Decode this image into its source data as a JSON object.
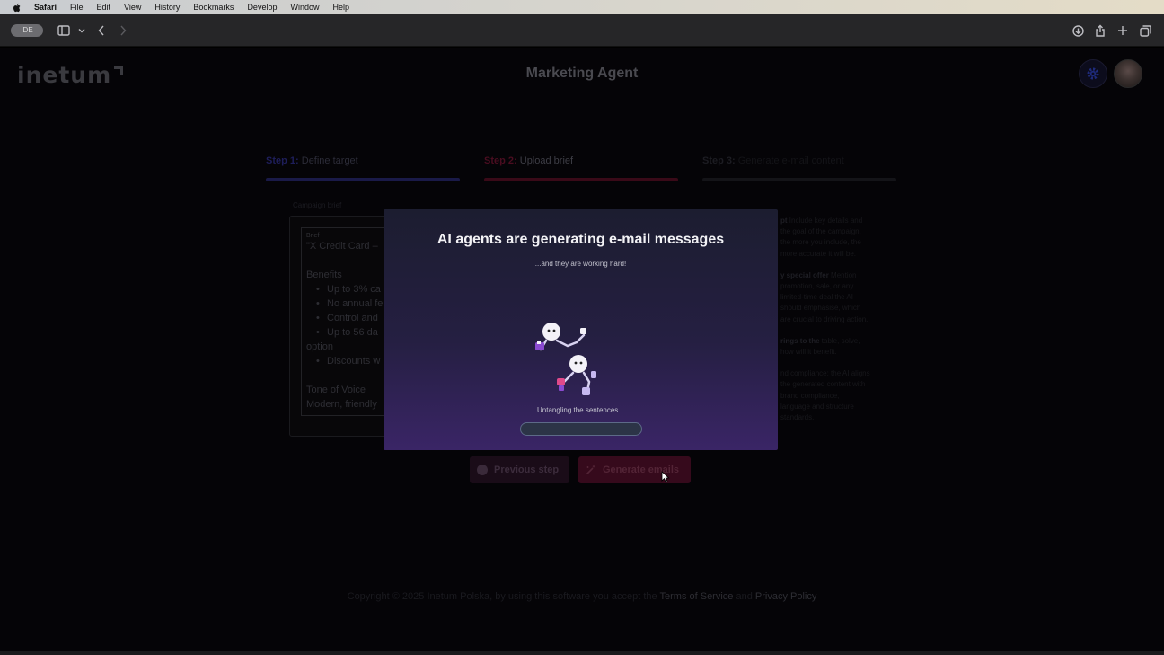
{
  "menubar": {
    "app": "Safari",
    "items": [
      "File",
      "Edit",
      "View",
      "History",
      "Bookmarks",
      "Develop",
      "Window",
      "Help"
    ]
  },
  "toolbar": {
    "pill_label": "IDE"
  },
  "header": {
    "logo": "inetum",
    "title": "Marketing Agent"
  },
  "steps": [
    {
      "num": "Step 1:",
      "label": "Define target"
    },
    {
      "num": "Step 2:",
      "label": "Upload brief"
    },
    {
      "num": "Step 3:",
      "label": "Generate e-mail content"
    }
  ],
  "form": {
    "caption": "Campaign brief",
    "field_label": "Brief",
    "lines": [
      {
        "text": "\"X Credit Card –",
        "bullet": false
      },
      {
        "text": "",
        "bullet": false
      },
      {
        "text": "Benefits",
        "bullet": false
      },
      {
        "text": "Up to 3% ca",
        "bullet": true
      },
      {
        "text": "No annual fe",
        "bullet": true
      },
      {
        "text": "Control and",
        "bullet": true
      },
      {
        "text": "Up to 56 da",
        "bullet": true
      },
      {
        "text": "option",
        "bullet": false
      },
      {
        "text": "Discounts w",
        "bullet": true
      },
      {
        "text": "",
        "bullet": false
      },
      {
        "text": "Tone of Voice",
        "bullet": false
      },
      {
        "text": "Modern, friendly",
        "bullet": false
      }
    ]
  },
  "tips": [
    {
      "bold": "pt",
      "text": " Include key details and the goal of the campaign, the more you include, the more accurate it will be."
    },
    {
      "bold": "y special offer",
      "text": " Mention promotion, sale, or any limited-time deal the AI should emphasise, which are crucial to driving action."
    },
    {
      "bold": "rings to the",
      "text": " table, solve, how will it benefit."
    },
    {
      "bold": "",
      "text": "nd compliance: the AI aligns the generated content with brand compliance, language and structure standards."
    }
  ],
  "actions": {
    "prev_label": "Previous step",
    "generate_label": "Generate emails"
  },
  "footer": {
    "prefix": "Copyright © 2025 Inetum Polska, by using this software you accept the ",
    "terms": "Terms of Service",
    "and": " and ",
    "privacy": "Privacy Policy"
  },
  "modal": {
    "title": "AI agents are generating e-mail messages",
    "subtitle": "...and they are working hard!",
    "status": "Untangling the sentences...",
    "progress": 0.0
  },
  "colors": {
    "modal_top": "#1c1d30",
    "modal_bottom": "#3a2566",
    "accent_blue": "#1a1a48",
    "accent_red": "#3a0a18"
  }
}
